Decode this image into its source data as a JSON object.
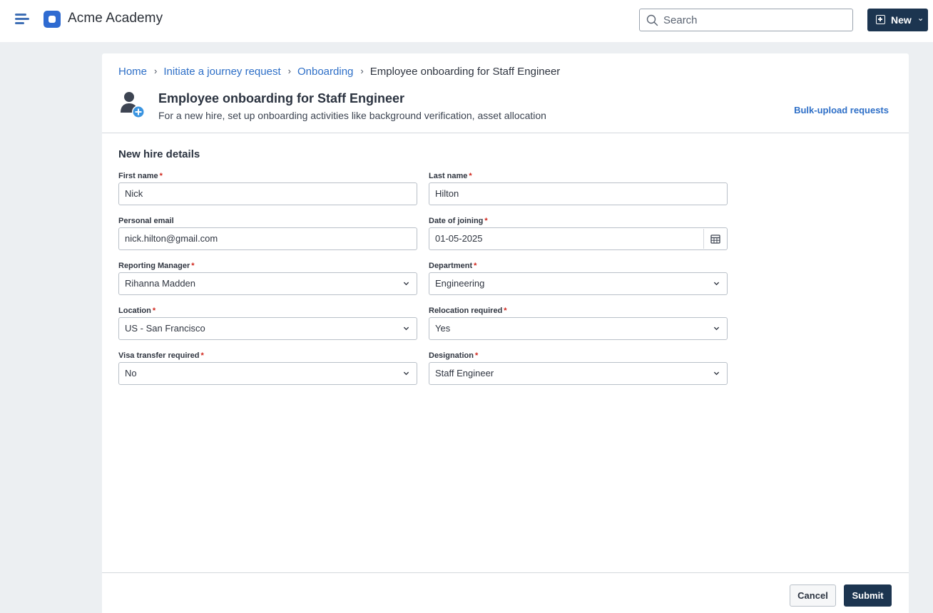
{
  "app": {
    "title": "Acme Academy"
  },
  "topbar": {
    "search_placeholder": "Search",
    "new_label": "New",
    "new_chevron": "⌄"
  },
  "breadcrumb": [
    {
      "label": "Home"
    },
    {
      "label": "Initiate a journey request"
    },
    {
      "label": "Onboarding"
    },
    {
      "label": "Employee onboarding for Staff Engineer"
    }
  ],
  "breadcrumb_separator": "›",
  "page": {
    "title": "Employee onboarding for Staff Engineer",
    "subtitle": "For a new hire, set up onboarding activities like background verification, asset allocation",
    "bulk_link": "Bulk-upload requests",
    "icon": "add-user-icon"
  },
  "form": {
    "section_title": "New hire details",
    "required_marker": "*",
    "first_name": {
      "label": "First name",
      "value": "Nick",
      "required": true
    },
    "last_name": {
      "label": "Last name",
      "value": "Hilton",
      "required": true
    },
    "personal_email": {
      "label": "Personal email",
      "value": "nick.hilton@gmail.com",
      "required": false
    },
    "date_of_joining": {
      "label": "Date of joining",
      "value": "01-05-2025",
      "required": true
    },
    "reporting_manager": {
      "label": "Reporting Manager",
      "value": "Rihanna Madden",
      "required": true
    },
    "department": {
      "label": "Department",
      "value": "Engineering",
      "required": true
    },
    "location": {
      "label": "Location",
      "value": "US - San Francisco",
      "required": true
    },
    "relocation_required": {
      "label": "Relocation required",
      "value": "Yes",
      "required": true
    },
    "visa_transfer_required": {
      "label": "Visa transfer required",
      "value": "No",
      "required": true
    },
    "designation": {
      "label": "Designation",
      "value": "Staff Engineer",
      "required": true
    }
  },
  "footer": {
    "cancel_label": "Cancel",
    "submit_label": "Submit"
  },
  "colors": {
    "primary_dark": "#1c3550",
    "link_blue": "#2e6fc7",
    "brand_blue": "#2f6bd1",
    "required_red": "#d0251b",
    "page_background": "#eceff2"
  }
}
